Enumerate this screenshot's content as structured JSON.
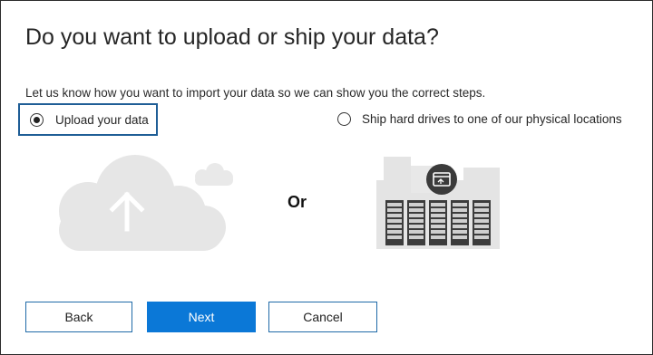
{
  "dialog": {
    "title": "Do you want to upload or ship your data?",
    "subtitle": "Let us know how you want to import your data so we can show you the correct steps."
  },
  "options": {
    "upload": {
      "label": "Upload your data",
      "selected": true
    },
    "ship": {
      "label": "Ship hard drives to one of our physical locations",
      "selected": false
    }
  },
  "illustrations": {
    "upload": "cloud-upload-icon",
    "ship": "datacenter-icon",
    "or_label": "Or"
  },
  "buttons": {
    "back": "Back",
    "next": "Next",
    "cancel": "Cancel"
  },
  "colors": {
    "accent": "#0b78d7",
    "focus_border": "#1f5e96",
    "illustration_gray": "#e6e6e6"
  }
}
